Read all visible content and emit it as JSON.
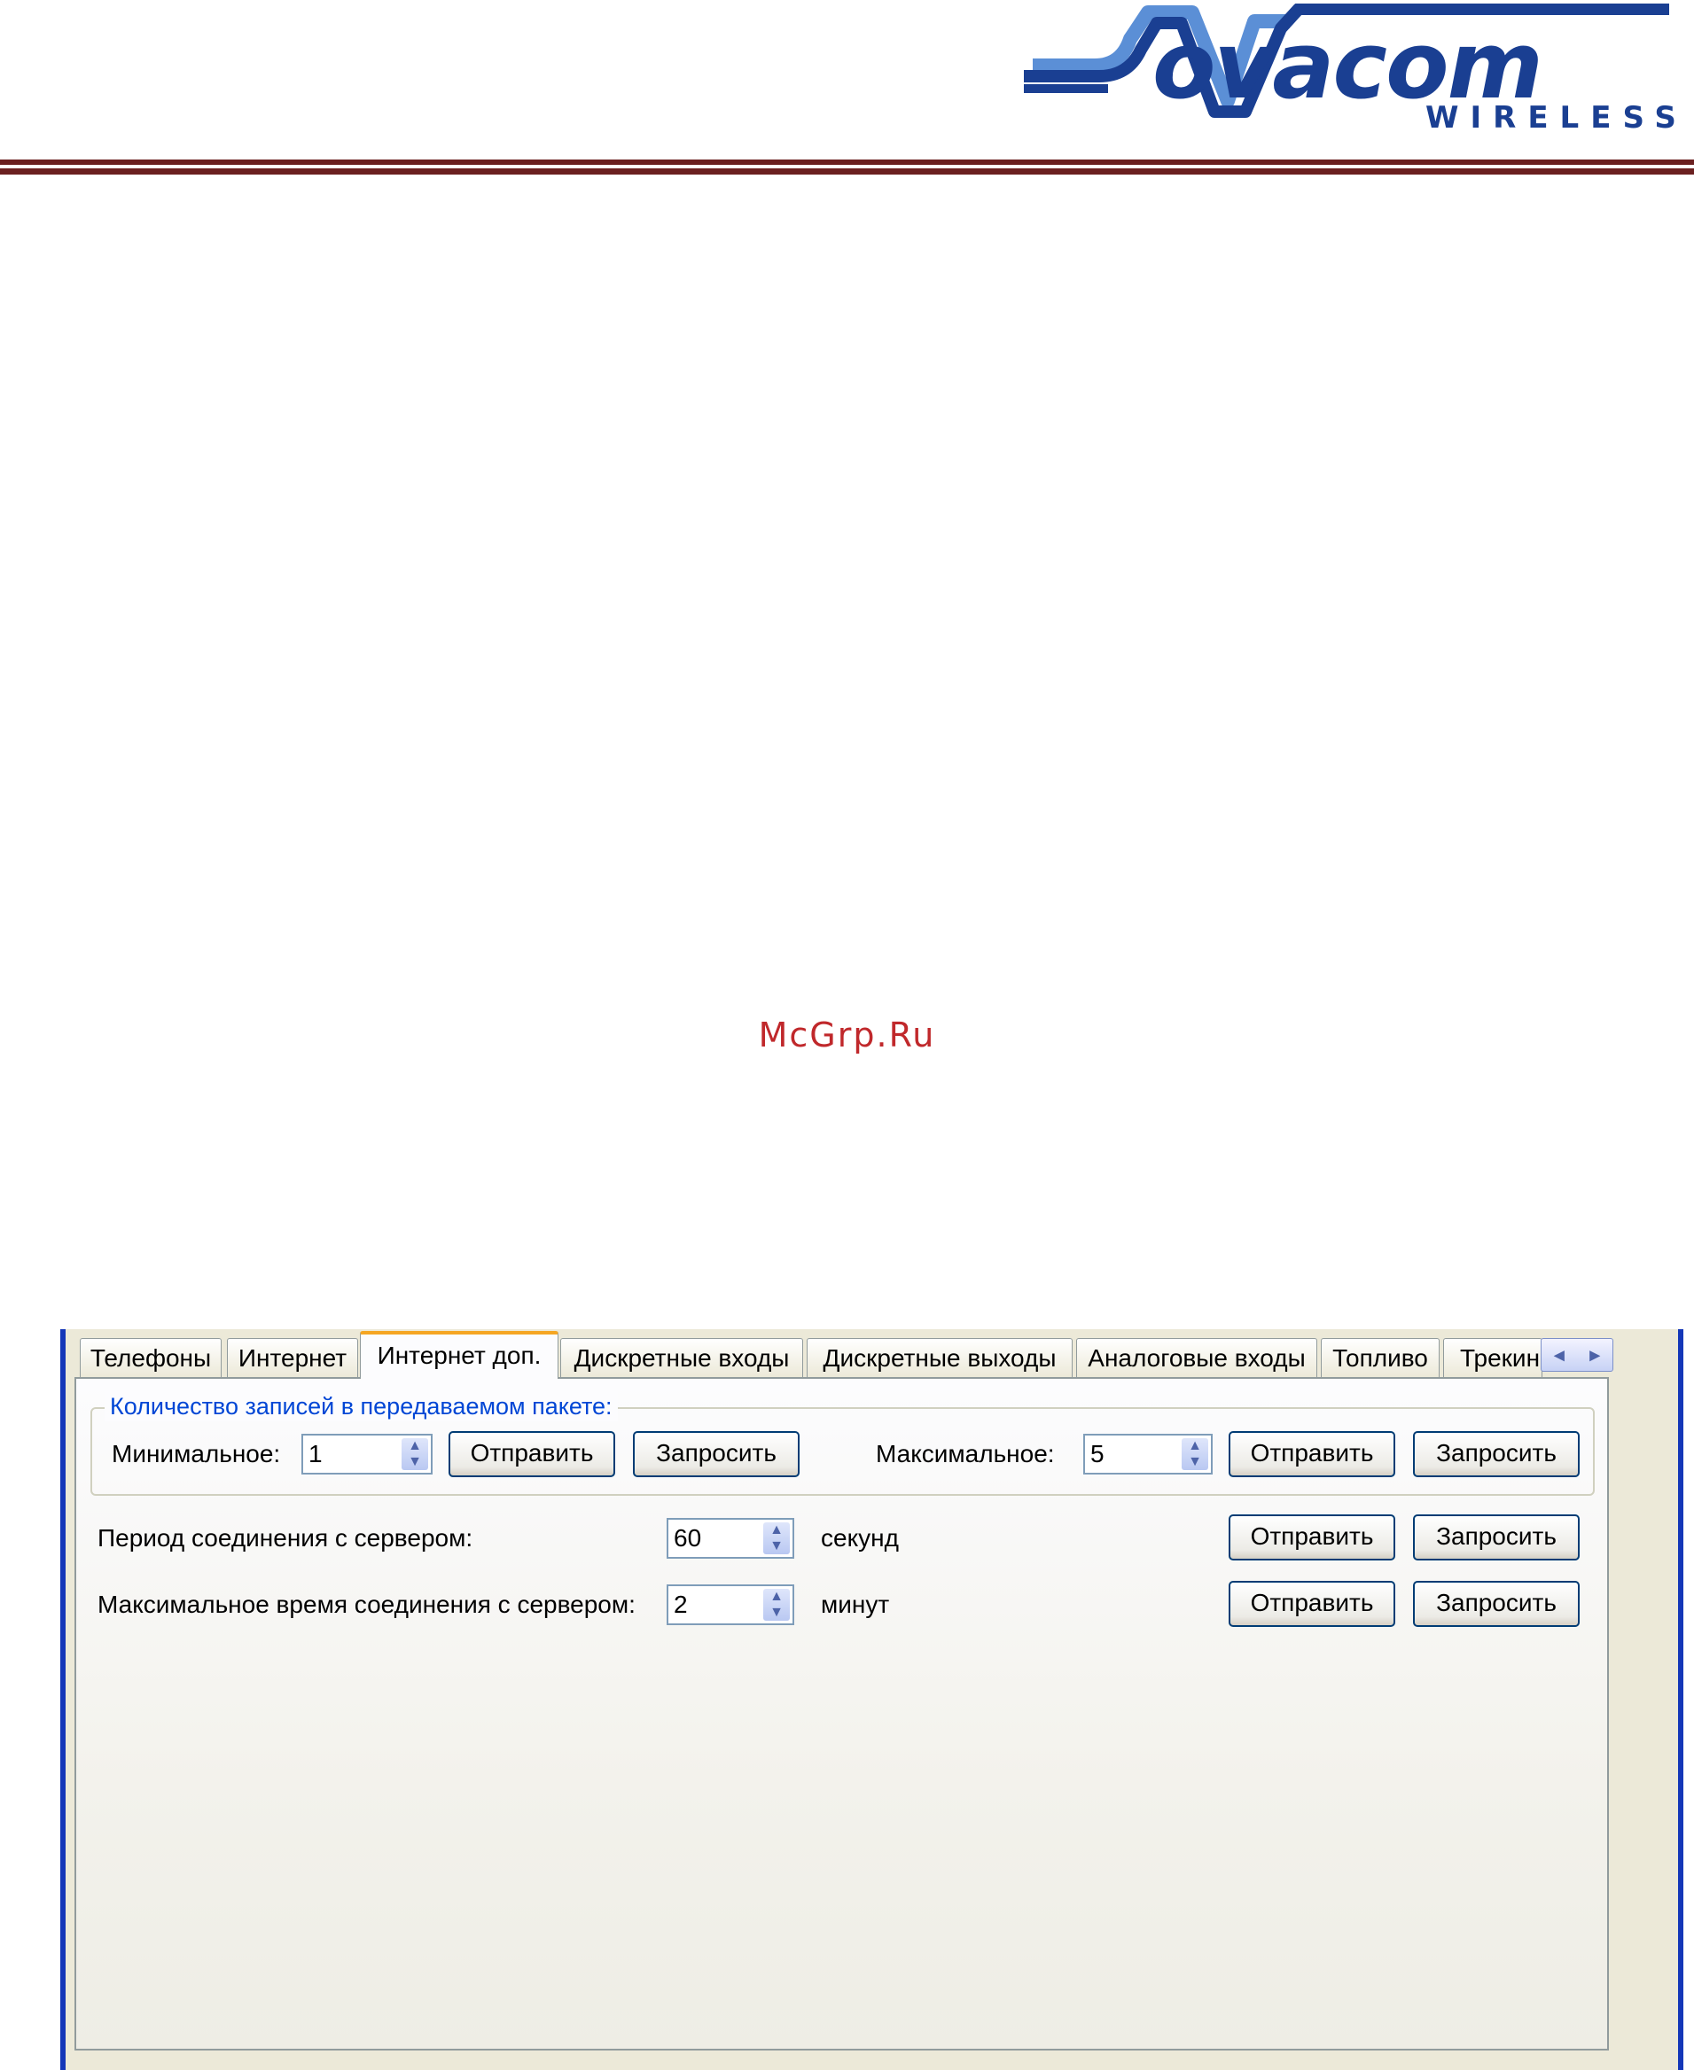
{
  "logo": {
    "word": "ovacom",
    "sub": "WIRELESS",
    "colors": {
      "navy": "#1a3f92",
      "light_blue": "#5b8fd6"
    }
  },
  "watermark": "McGrp.Ru",
  "tabs": [
    {
      "label": "Телефоны"
    },
    {
      "label": "Интернет"
    },
    {
      "label": "Интернет доп."
    },
    {
      "label": "Дискретные входы"
    },
    {
      "label": "Дискретные выходы"
    },
    {
      "label": "Аналоговые входы"
    },
    {
      "label": "Топливо"
    },
    {
      "label": "Трекинг"
    }
  ],
  "active_tab": "Интернет доп.",
  "tab_scroll": {
    "left": "◂",
    "right": "▸"
  },
  "group": {
    "title": "Количество записей в передаваемом пакете:",
    "min_label": "Минимальное:",
    "min_value": "1",
    "max_label": "Максимальное:",
    "max_value": "5"
  },
  "period": {
    "label": "Период соединения с сервером:",
    "value": "60",
    "unit": "секунд"
  },
  "max_time": {
    "label": "Максимальное время соединения с сервером:",
    "value": "2",
    "unit": "минут"
  },
  "buttons": {
    "send": "Отправить",
    "request": "Запросить"
  },
  "colors": {
    "accent_blue": "#0046d5",
    "window_border": "#1437b8",
    "rule": "#6b2020",
    "tab_active": "#f5a623"
  }
}
